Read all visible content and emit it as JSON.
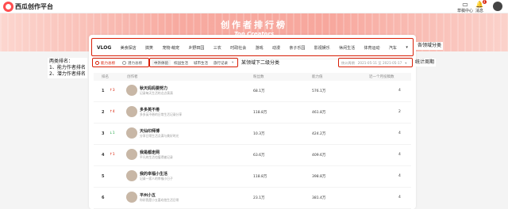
{
  "topbar": {
    "logo_text": "西瓜创作平台",
    "drafts_label": "草稿中心",
    "messages_label": "消息",
    "messages_badge": "4"
  },
  "banner": {
    "title": "创作者排行榜",
    "subtitle": "Top Creators"
  },
  "tabs": [
    {
      "label": "VLOG",
      "active": true
    },
    {
      "label": "美食探店"
    },
    {
      "label": "搞笑"
    },
    {
      "label": "宠物·萌宠"
    },
    {
      "label": "乡野田园"
    },
    {
      "label": "三农"
    },
    {
      "label": "时政社会"
    },
    {
      "label": "游戏"
    },
    {
      "label": "动漫"
    },
    {
      "label": "亲子乐园"
    },
    {
      "label": "影视娱乐"
    },
    {
      "label": "休闲生活"
    },
    {
      "label": "体育运动"
    },
    {
      "label": "汽车"
    }
  ],
  "tabs_more": "▾",
  "rank_types": [
    {
      "label": "能力总榜",
      "selected": true
    },
    {
      "label": "潜力总榜",
      "selected": false
    }
  ],
  "subtabs": [
    "中外体验",
    "校园生活",
    "城市生活",
    "旅行记录"
  ],
  "subtabs_more": "▾",
  "period": {
    "label": "统计周期",
    "range": "2021-05-11 至 2021-05-17",
    "arrow": "▾"
  },
  "table": {
    "headers": [
      "排名",
      "创作者",
      "粉丝数",
      "能力值",
      "近一个月投稿数"
    ]
  },
  "rows": [
    {
      "rank": "1",
      "change": "↑3",
      "dir": "up",
      "name": "秋天妈妈要努力",
      "desc": "记录每天生活的点点滴滴",
      "fans": "68.1万",
      "ability": "576.1万",
      "count": "4"
    },
    {
      "rank": "2",
      "change": "↑4",
      "dir": "up",
      "name": "多多英不倦",
      "desc": "多多英不倦的日常生活记录分享",
      "fans": "118.8万",
      "ability": "461.8万",
      "count": "2"
    },
    {
      "rank": "3",
      "change": "↓1",
      "dir": "dn",
      "name": "天仙印拜博",
      "desc": "分享日常生活点滴与美好时光",
      "fans": "10.3万",
      "ability": "424.2万",
      "count": "4"
    },
    {
      "rank": "4",
      "change": "↑1",
      "dir": "up",
      "name": "我是都走网",
      "desc": "平凡的生活也值得被记录",
      "fans": "63.6万",
      "ability": "409.6万",
      "count": "4"
    },
    {
      "rank": "5",
      "change": "",
      "dir": "",
      "name": "我的幸福小生活",
      "desc": "记录一家人的幸福小日子",
      "fans": "118.8万",
      "ability": "398.8万",
      "count": "4"
    },
    {
      "rank": "6",
      "change": "",
      "dir": "",
      "name": "平州小五",
      "desc": "你好我是小五喜欢拍生活日常",
      "fans": "23.1万",
      "ability": "381.4万",
      "count": "4"
    }
  ],
  "annotations": {
    "tabs_note": "各领域分类",
    "rank_note_title": "两类排名：",
    "rank_note_1": "1、能力作者排名",
    "rank_note_2": "2、潜力作者排名",
    "sub_note": "某领域下二级分类",
    "period_note": "统计周期"
  },
  "colors": {
    "accent": "#d81e06",
    "banner": "#f7aaa0"
  }
}
